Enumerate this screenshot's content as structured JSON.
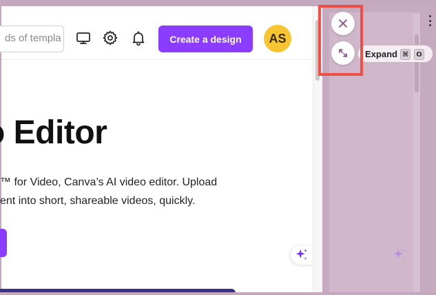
{
  "header": {
    "search_placeholder": "ds of templa",
    "icons": [
      "monitor-icon",
      "gear-icon",
      "bell-icon"
    ],
    "create_button_label": "Create a design",
    "avatar_initials": "AS"
  },
  "hero": {
    "title": "o Editor",
    "description_line1": "™ for Video, Canva’s AI video editor. Upload",
    "description_line2": "ent into short, shareable videos, quickly."
  },
  "side_controls": {
    "close_icon": "close-icon",
    "expand_icon": "expand-icon",
    "tooltip_label": "Expand",
    "shortcut_key_1": "⌘",
    "shortcut_key_2": "O"
  },
  "colors": {
    "accent": "#8b3dff",
    "avatar_bg": "#f7c531",
    "highlight": "#ef4f44",
    "panel_bg": "#d0b7ca"
  }
}
